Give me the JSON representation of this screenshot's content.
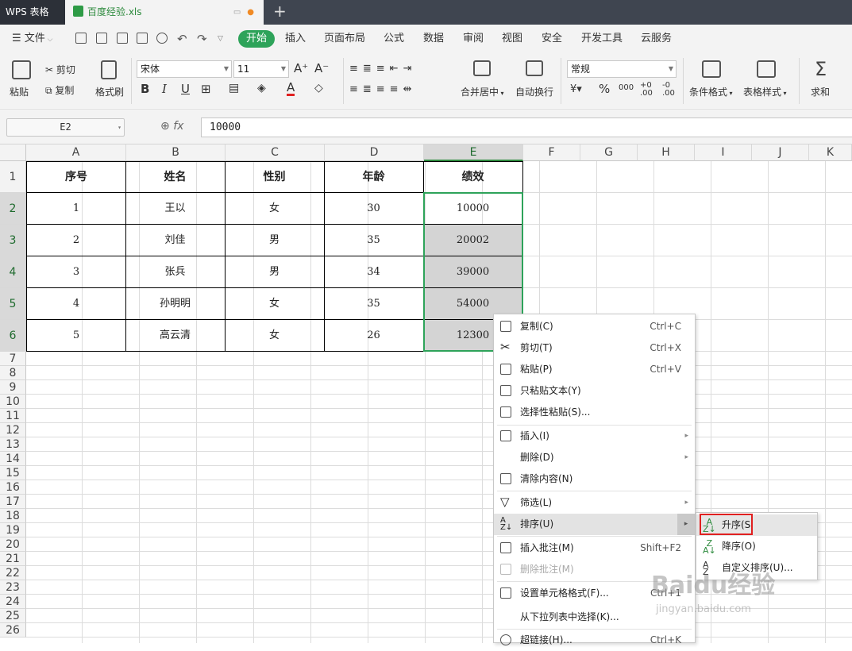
{
  "app": {
    "name": "WPS 表格"
  },
  "doc_tab": {
    "filename": "百度经验.xls"
  },
  "menu": {
    "file": "文件",
    "tabs": [
      "开始",
      "插入",
      "页面布局",
      "公式",
      "数据",
      "审阅",
      "视图",
      "安全",
      "开发工具",
      "云服务"
    ]
  },
  "ribbon": {
    "paste": "粘贴",
    "cut": "剪切",
    "copy": "复制",
    "format_painter": "格式刷",
    "font_name": "宋体",
    "font_size": "11",
    "bold": "B",
    "italic": "I",
    "underline": "U",
    "font_color_glyph": "A",
    "merge_center": "合并居中",
    "wrap_text": "自动换行",
    "number_format": "常规",
    "percent": "%",
    "cond_format": "条件格式",
    "table_style": "表格样式",
    "sum": "求和"
  },
  "formula_bar": {
    "cell_ref": "E2",
    "fx": "fx",
    "value": "10000"
  },
  "columns": [
    "A",
    "B",
    "C",
    "D",
    "E",
    "F",
    "G",
    "H",
    "I",
    "J",
    "K"
  ],
  "rows": [
    "1",
    "2",
    "3",
    "4",
    "5",
    "6",
    "7",
    "8",
    "9",
    "10",
    "11",
    "12",
    "13",
    "14",
    "15",
    "16",
    "17",
    "18",
    "19",
    "20",
    "21",
    "22",
    "23",
    "24",
    "25",
    "26"
  ],
  "table": {
    "headers": [
      "序号",
      "姓名",
      "性别",
      "年龄",
      "绩效"
    ],
    "rows": [
      [
        "1",
        "王以",
        "女",
        "30",
        "10000"
      ],
      [
        "2",
        "刘佳",
        "男",
        "35",
        "20002"
      ],
      [
        "3",
        "张兵",
        "男",
        "34",
        "39000"
      ],
      [
        "4",
        "孙明明",
        "女",
        "35",
        "54000"
      ],
      [
        "5",
        "高云清",
        "女",
        "26",
        "12300"
      ]
    ]
  },
  "context_menu": {
    "copy": {
      "label": "复制(C)",
      "shortcut": "Ctrl+C"
    },
    "cut": {
      "label": "剪切(T)",
      "shortcut": "Ctrl+X"
    },
    "paste": {
      "label": "粘贴(P)",
      "shortcut": "Ctrl+V"
    },
    "paste_text": {
      "label": "只粘贴文本(Y)"
    },
    "paste_special": {
      "label": "选择性粘贴(S)..."
    },
    "insert": {
      "label": "插入(I)"
    },
    "delete": {
      "label": "删除(D)"
    },
    "clear": {
      "label": "清除内容(N)"
    },
    "filter": {
      "label": "筛选(L)"
    },
    "sort": {
      "label": "排序(U)"
    },
    "insert_comment": {
      "label": "插入批注(M)",
      "shortcut": "Shift+F2"
    },
    "delete_comment": {
      "label": "删除批注(M)"
    },
    "format_cells": {
      "label": "设置单元格格式(F)...",
      "shortcut": "Ctrl+1"
    },
    "pick_list": {
      "label": "从下拉列表中选择(K)..."
    },
    "hyperlink": {
      "label": "超链接(H)...",
      "shortcut": "Ctrl+K"
    }
  },
  "sort_submenu": {
    "asc": "升序(S",
    "desc": "降序(O)",
    "custom": "自定义排序(U)..."
  },
  "watermark": {
    "brand": "Baidu经验",
    "url": "jingyan.baidu.com"
  },
  "colors": {
    "accent": "#2ea35a",
    "highlight": "#e02020"
  }
}
